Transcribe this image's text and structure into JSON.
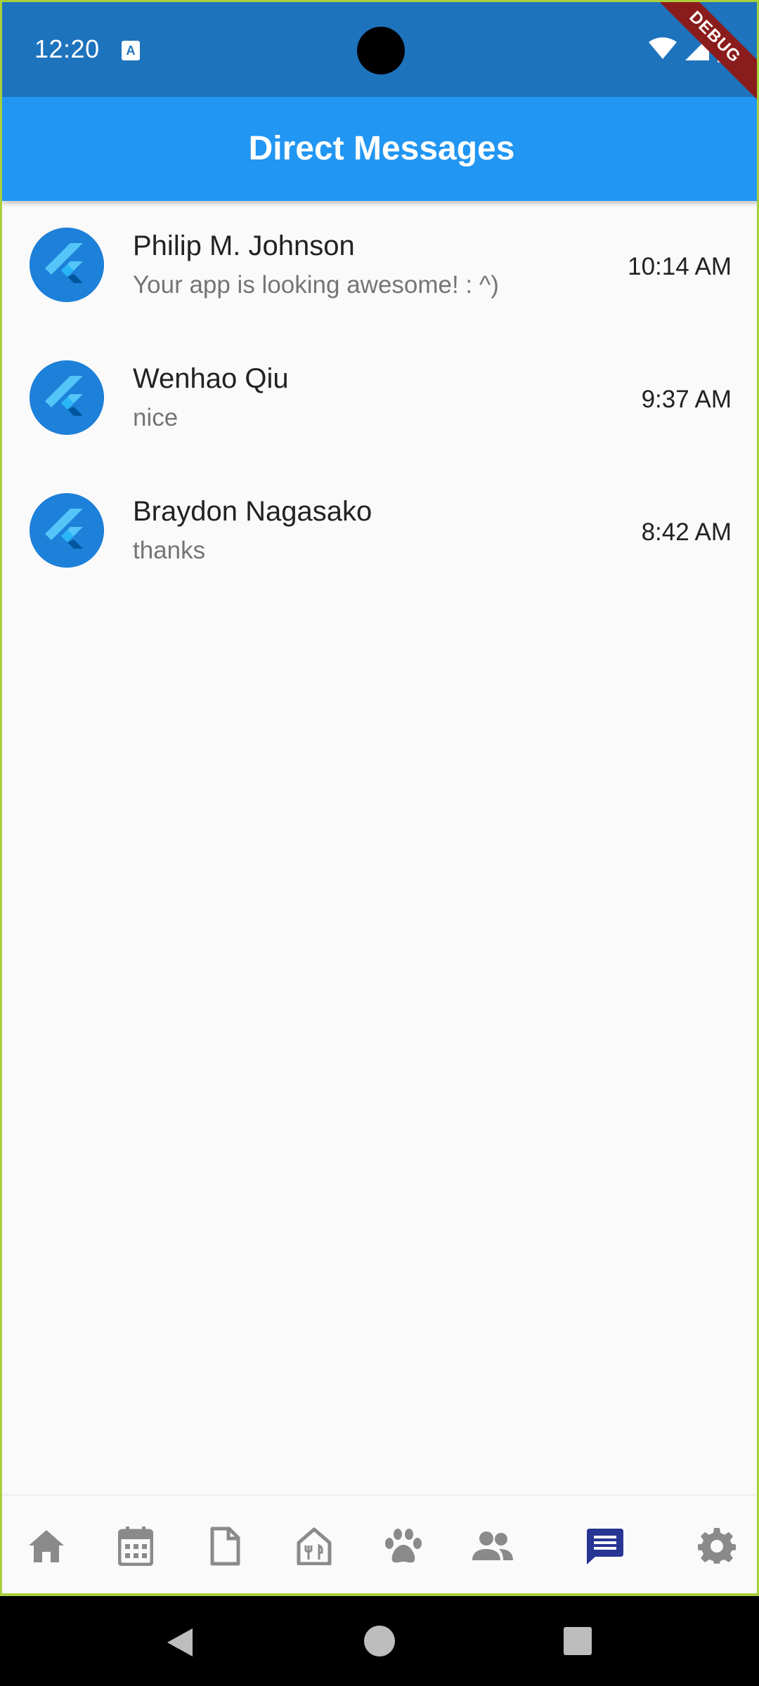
{
  "status_bar": {
    "time": "12:20"
  },
  "debug_label": "DEBUG",
  "app_bar": {
    "title": "Direct Messages"
  },
  "conversations": [
    {
      "name": "Philip M. Johnson",
      "message": "Your app is looking awesome! : ^)",
      "time": "10:14 AM"
    },
    {
      "name": "Wenhao Qiu",
      "message": "nice",
      "time": "9:37 AM"
    },
    {
      "name": "Braydon Nagasako",
      "message": "thanks",
      "time": "8:42 AM"
    }
  ],
  "bottom_nav": {
    "items": [
      "home-icon",
      "calendar-icon",
      "document-icon",
      "dining-icon",
      "pets-icon",
      "people-icon",
      "chat-icon",
      "settings-icon"
    ],
    "active": "chat-icon",
    "active_color": "#283593",
    "inactive_color": "#8a8a8a"
  },
  "colors": {
    "status_bar": "#1e73bd",
    "app_bar": "#2196f3",
    "avatar": "#1d80d9"
  }
}
